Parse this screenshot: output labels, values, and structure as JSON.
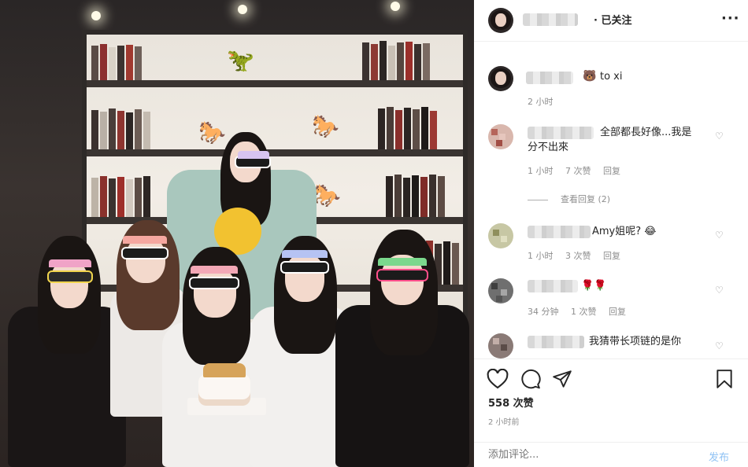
{
  "header": {
    "follow_label": "· 已关注",
    "more_label": "···"
  },
  "caption": {
    "mention": "to xi",
    "time": "2 小时"
  },
  "comments": [
    {
      "text": "全部都長好像...我是分不出來",
      "line1": "全部都長好像...我是",
      "line2": "分不出來",
      "time": "1 小时",
      "likes": "7 次赞",
      "reply": "回复"
    },
    {
      "view_replies": "查看回复 (2)"
    },
    {
      "text": "Amy姐呢? 😂",
      "time": "1 小时",
      "likes": "3 次赞",
      "reply": "回复"
    },
    {
      "text": "🌹🌹",
      "time": "34 分钟",
      "likes": "1 次赞",
      "reply": "回复"
    },
    {
      "text": "我猜带长项链的是你"
    }
  ],
  "actions": {
    "like_icon": "heart-icon",
    "comment_icon": "comment-icon",
    "share_icon": "paper-plane-icon",
    "save_icon": "bookmark-icon"
  },
  "likes_count": "558 次赞",
  "post_time": "2 小时前",
  "comment_box": {
    "placeholder": "添加评论...",
    "post_label": "发布"
  },
  "colors": {
    "accent_blue_disabled": "#8fc2f4",
    "secondary_text": "#8e8e8e",
    "primary_text": "#262626"
  }
}
